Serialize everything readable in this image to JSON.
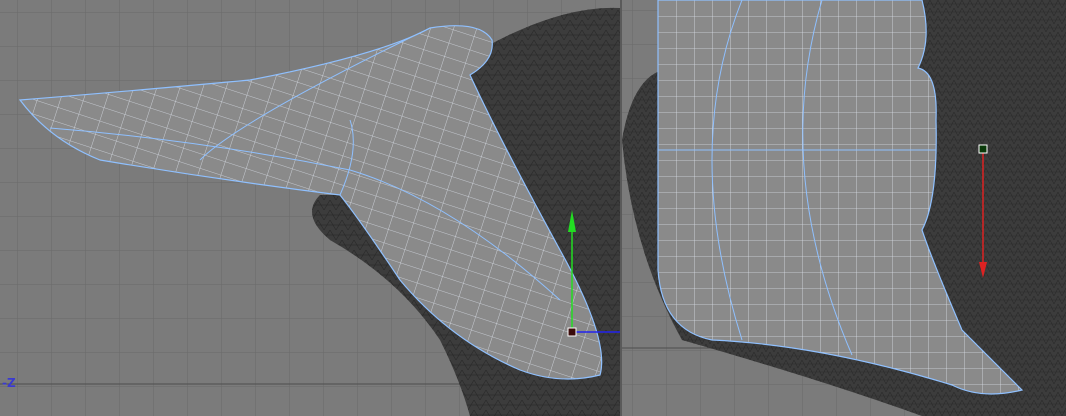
{
  "viewports": [
    {
      "name": "side",
      "axis_label": "-Z",
      "gizmo_axes": [
        "y",
        "x"
      ]
    },
    {
      "name": "front",
      "gizmo_axes": [
        "y-down"
      ]
    }
  ],
  "colors": {
    "background": "#7b7b7b",
    "grid": "#6a6a6a",
    "grid_axis": "#4e4e4e",
    "mesh_dark": "#3c3c3c",
    "wire_surface": "#8a8a8a",
    "wire_lines": "#d8dde6",
    "wire_edges": "#8fc0ff",
    "gizmo_y": "#22dd22",
    "gizmo_x": "#2222ee",
    "gizmo_red": "#dd2222"
  }
}
